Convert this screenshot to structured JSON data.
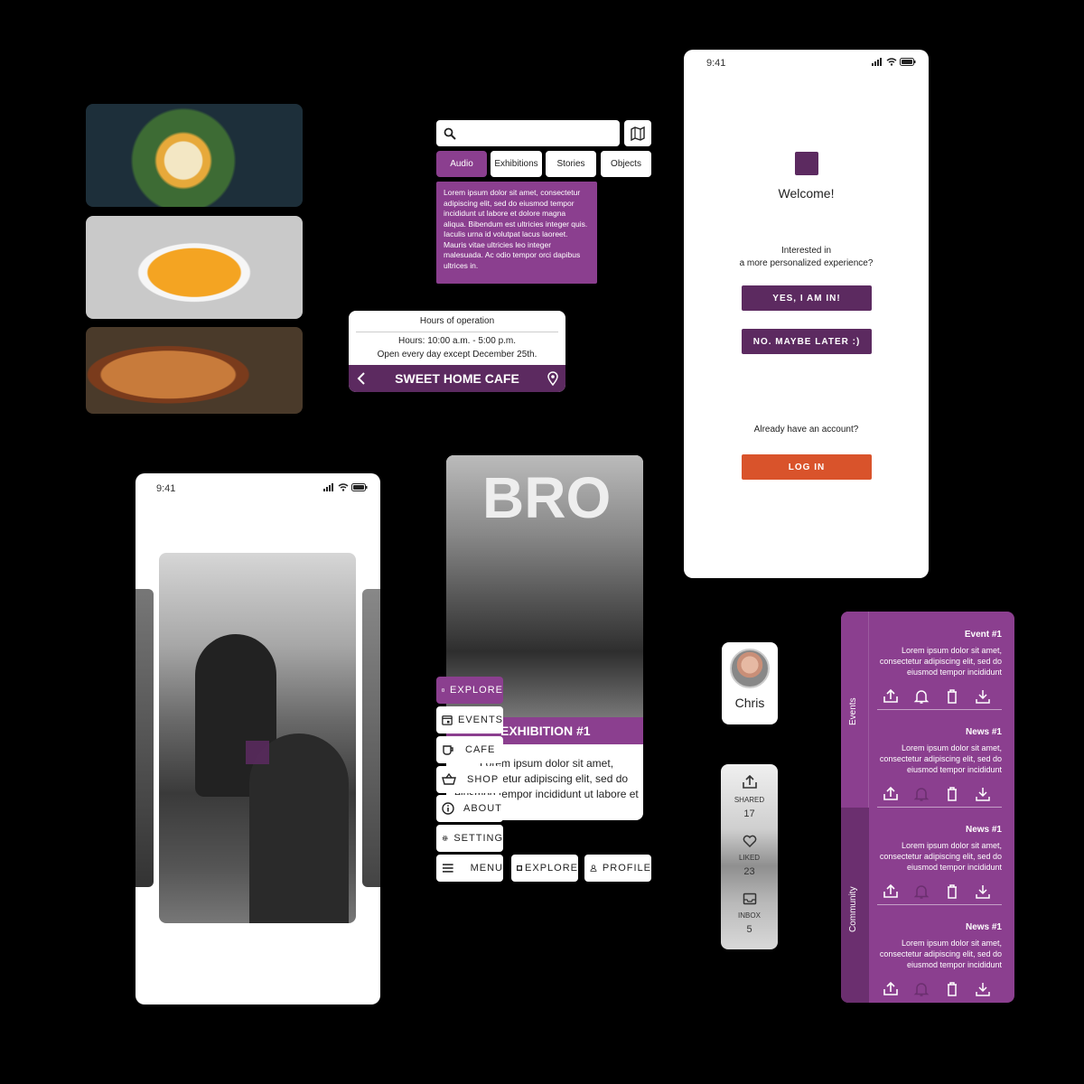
{
  "colors": {
    "purple": "#8b3f8f",
    "dark_purple": "#5c2a60",
    "login": "#d9532b"
  },
  "search": {
    "placeholder": ""
  },
  "filters": [
    {
      "label": "Audio",
      "active": true
    },
    {
      "label": "Exhibitions",
      "active": false
    },
    {
      "label": "Stories",
      "active": false
    },
    {
      "label": "Objects",
      "active": false
    }
  ],
  "lorem_card": {
    "text": "Lorem ipsum dolor sit amet, consectetur adipiscing elit, sed do eiusmod tempor incididunt ut labore et dolore magna aliqua. Bibendum est ultricies integer quis. Iaculis urna id volutpat lacus laoreet. Mauris vitae ultricies leo integer malesuada. Ac odio tempor orci dapibus ultrices in."
  },
  "cafe": {
    "hours_title": "Hours of operation",
    "hours": "Hours: 10:00 a.m. - 5:00 p.m.",
    "note": "Open every day except December 25th.",
    "name": "SWEET HOME CAFE"
  },
  "welcome_phone": {
    "time": "9:41",
    "welcome": "Welcome!",
    "question_line1": "Interested in",
    "question_line2": "a more personalized experience?",
    "yes_button": "YES, I AM IN!",
    "later_button": "NO. MAYBE LATER :)",
    "account_prompt": "Already have an account?",
    "login_button": "LOG IN"
  },
  "photo_phone": {
    "time": "9:41"
  },
  "exhibition": {
    "overlay_text": "BRO",
    "title": "EXHIBITION #1",
    "body": "Lorem ipsum dolor sit amet, consectetur adipiscing elit, sed do eiusmod tempor incididunt ut labore et"
  },
  "menu": {
    "items": [
      {
        "label": "EXPLORE",
        "icon": "museum-logo-icon"
      },
      {
        "label": "EVENTS",
        "icon": "calendar-icon"
      },
      {
        "label": "CAFE",
        "icon": "coffee-cup-icon"
      },
      {
        "label": "SHOP",
        "icon": "basket-icon"
      },
      {
        "label": "ABOUT",
        "icon": "info-icon"
      },
      {
        "label": "SETTING",
        "icon": "gear-icon"
      }
    ],
    "bottom": [
      {
        "label": "MENU",
        "icon": "hamburger-icon"
      },
      {
        "label": "EXPLORE",
        "icon": "museum-logo-icon"
      },
      {
        "label": "PROFILE",
        "icon": "person-icon"
      }
    ]
  },
  "profile": {
    "name": "Chris"
  },
  "stats": [
    {
      "label": "SHARED",
      "value": "17",
      "icon": "share-icon"
    },
    {
      "label": "LIKED",
      "value": "23",
      "icon": "heart-icon"
    },
    {
      "label": "INBOX",
      "value": "5",
      "icon": "inbox-icon"
    }
  ],
  "community": {
    "tabs": [
      "Events",
      "Community"
    ],
    "items": [
      {
        "title": "Event #1",
        "desc": "Lorem ipsum dolor sit amet, consectetur adipiscing elit, sed do eiusmod tempor incididunt"
      },
      {
        "title": "News #1",
        "desc": "Lorem ipsum dolor sit amet, consectetur adipiscing elit, sed do eiusmod tempor incididunt"
      },
      {
        "title": "News #1",
        "desc": "Lorem ipsum dolor sit amet, consectetur adipiscing elit, sed do eiusmod tempor incididunt"
      },
      {
        "title": "News #1",
        "desc": "Lorem ipsum dolor sit amet, consectetur adipiscing elit, sed do eiusmod tempor incididunt"
      }
    ]
  }
}
